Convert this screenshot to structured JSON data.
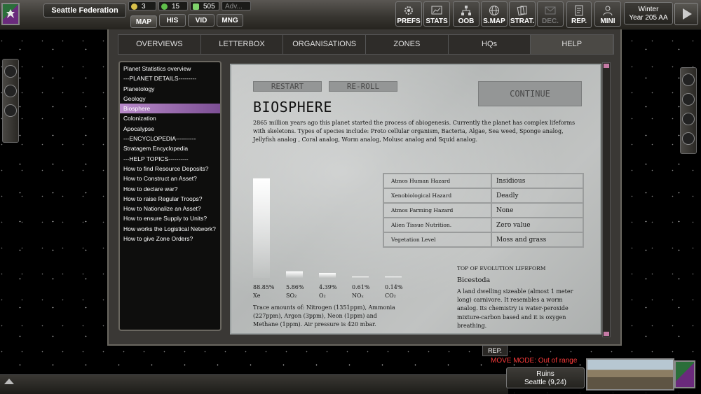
{
  "topbar": {
    "faction": "Seattle Federation",
    "resources": [
      {
        "icon": "credits-icon",
        "value": "3",
        "color": "#d8c04a"
      },
      {
        "icon": "food-icon",
        "value": "15",
        "color": "#5fbf4a"
      },
      {
        "icon": "money-icon",
        "value": "505",
        "color": "#7ed36b"
      },
      {
        "icon": "advisor-icon",
        "value": "Adv...",
        "color": "#888888"
      }
    ],
    "subtabs": [
      "MAP",
      "HIS",
      "VID",
      "MNG"
    ],
    "buttons": [
      {
        "label": "PREFS",
        "icon": "gear-icon"
      },
      {
        "label": "STATS",
        "icon": "chart-icon"
      },
      {
        "label": "OOB",
        "icon": "hierarchy-icon"
      },
      {
        "label": "S.MAP",
        "icon": "globe-icon"
      },
      {
        "label": "STRAT.",
        "icon": "cards-icon"
      },
      {
        "label": "DEC.",
        "icon": "mail-icon"
      },
      {
        "label": "REP.",
        "icon": "report-icon"
      },
      {
        "label": "MINI",
        "icon": "person-icon"
      }
    ],
    "season": "Winter",
    "year": "Year 205 AA"
  },
  "nav_tabs": [
    "OVERVIEWS",
    "LETTERBOX",
    "ORGANISATIONS",
    "ZONES",
    "HQs",
    "HELP"
  ],
  "left_menu": [
    "Planet Statistics overview",
    "---PLANET DETAILS---------",
    "Planetology",
    "Geology",
    "Biosphere",
    "Colonization",
    "Apocalypse",
    "---ENCYCLOPEDIA----------",
    "Stratagem Encyclopedia",
    "---HELP TOPICS----------",
    "How to find Resource Deposits?",
    "How to Construct an Asset?",
    "How to declare war?",
    "How to raise Regular Troops?",
    "How to Nationalize an Asset?",
    "How to ensure Supply to Units?",
    "How works the Logistical Network?",
    "How to give Zone Orders?"
  ],
  "paper": {
    "restart_label": "RESTART",
    "reroll_label": "RE-ROLL",
    "continue_label": "CONTINUE",
    "title": "BIOSPHERE",
    "description": "2865 million years ago this planet started the process of abiogenesis. Currently the planet has complex lifeforms with skeletons. Types of species include: Proto cellular organism, Bacteria, Algae, Sea weed, Sponge analog, Jellyfish analog , Coral analog, Worm analog, Molusc analog and Squid analog.",
    "hazards": [
      {
        "label": "Atmos Human Hazard",
        "value": "Insidious"
      },
      {
        "label": "Xenobiological Hazard",
        "value": "Deadly"
      },
      {
        "label": "Atmos Farming Hazard",
        "value": "None"
      },
      {
        "label": "Alien Tissue Nutrition.",
        "value": "Zero value"
      },
      {
        "label": "Vegetation Level",
        "value": "Moss and grass"
      }
    ],
    "trace": "Trace amounts of: Nitrogen (1351ppm), Ammonia (227ppm), Argon (3ppm), Neon (1ppm) and Methane (1ppm). Air pressure is 420 mbar.",
    "life_heading": "TOP OF EVOLUTION LIFEFORM",
    "life_name": "Bicestoda",
    "life_desc": "A land dwelling sizeable (almost 1 meter long)  carnivore. It resembles a worm analog. Its chemistry is water-peroxide mixture-carbon based and it is oxygen breathing."
  },
  "chart_data": {
    "type": "bar",
    "categories": [
      "Xe",
      "SO₂",
      "O₂",
      "NOₓ",
      "CO₂"
    ],
    "values": [
      88.85,
      5.86,
      4.39,
      0.61,
      0.14
    ],
    "value_labels": [
      "88.85%",
      "5.86%",
      "4.39%",
      "0.61%",
      "0.14%"
    ],
    "ylim": [
      0,
      100
    ],
    "grid": false
  },
  "bottom": {
    "rep_label": "REP.",
    "move_mode": "MOVE MODE: Out of range",
    "location_name": "Ruins",
    "location_coords": "Seattle (9,24)"
  }
}
